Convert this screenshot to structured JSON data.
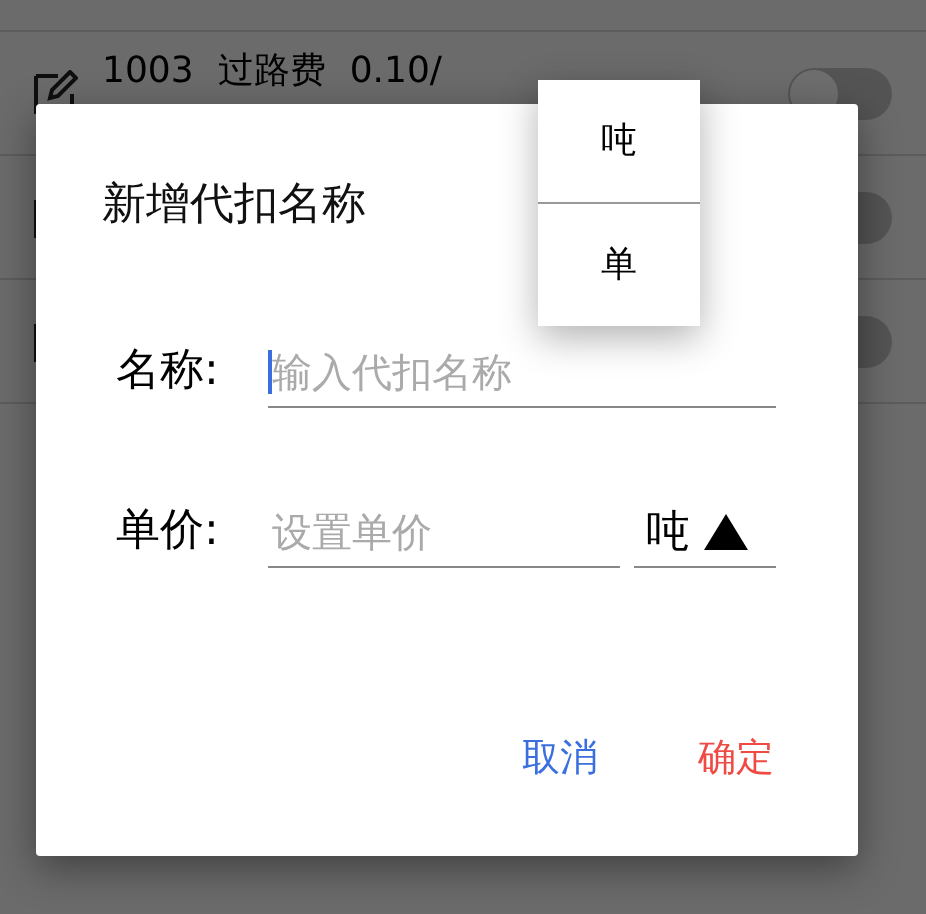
{
  "list": {
    "rows": [
      {
        "code": "1003",
        "name": "过路费",
        "price": "0.10/",
        "on": false
      },
      {
        "on": false
      },
      {
        "on": false
      }
    ]
  },
  "dialog": {
    "title": "新增代扣名称",
    "fields": [
      {
        "kind": "text",
        "label": "名称:",
        "placeholder": "输入代扣名称",
        "focused": true
      },
      {
        "kind": "select",
        "label": "单价:",
        "placeholder": "设置单价",
        "unit": "吨",
        "expanded": true
      }
    ],
    "buttons": [
      {
        "kind": "cancel",
        "label": "取消"
      },
      {
        "kind": "confirm",
        "label": "确定"
      }
    ]
  },
  "dropdown": {
    "options": [
      "吨",
      "单"
    ]
  }
}
